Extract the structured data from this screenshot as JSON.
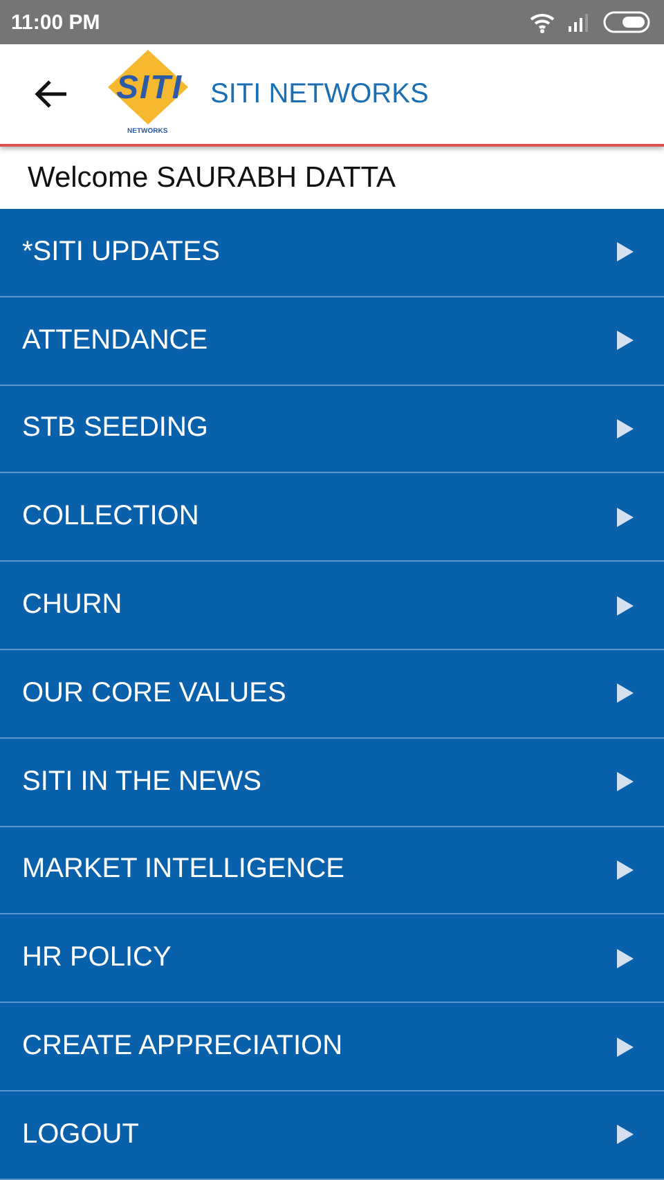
{
  "status_bar": {
    "time": "11:00 PM"
  },
  "app_bar": {
    "logo_text": "SITI",
    "logo_subtext": "NETWORKS",
    "title": "SITI NETWORKS"
  },
  "welcome": "Welcome SAURABH DATTA",
  "menu": [
    {
      "label": "*SITI UPDATES"
    },
    {
      "label": "ATTENDANCE"
    },
    {
      "label": "STB SEEDING"
    },
    {
      "label": "COLLECTION"
    },
    {
      "label": "CHURN"
    },
    {
      "label": "OUR CORE VALUES"
    },
    {
      "label": "SITI IN THE NEWS"
    },
    {
      "label": "MARKET INTELLIGENCE"
    },
    {
      "label": "HR POLICY"
    },
    {
      "label": "CREATE APPRECIATION"
    },
    {
      "label": "LOGOUT"
    }
  ]
}
